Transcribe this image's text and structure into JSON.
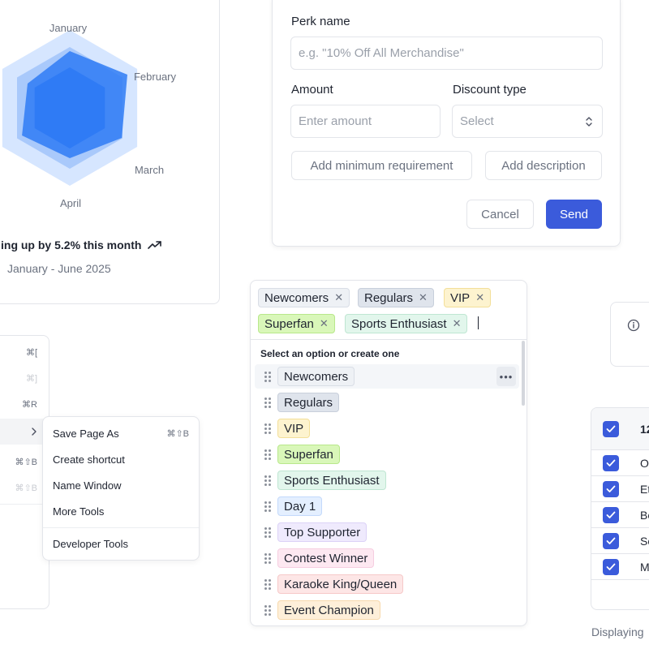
{
  "radar_chart": {
    "month_labels": [
      "January",
      "February",
      "March",
      "April"
    ],
    "trend_text": "ing up by 5.2% this month",
    "trend_icon": "trending-up-icon",
    "date_range": "January - June 2025",
    "colors": {
      "outer": "#d6e6ff",
      "middle": "#a9c9fb",
      "inner": "#2f7bf5"
    }
  },
  "perk_form": {
    "perk_name_label": "Perk name",
    "perk_name_placeholder": "e.g. \"10% Off All Merchandise\"",
    "amount_label": "Amount",
    "amount_placeholder": "Enter amount",
    "discount_type_label": "Discount type",
    "discount_type_value": "Select",
    "add_min_requirement": "Add minimum requirement",
    "add_description": "Add description",
    "cancel": "Cancel",
    "send": "Send",
    "accent_color": "#3b5bdb"
  },
  "context_menu": {
    "shortcuts": [
      {
        "text": "⌘[",
        "dim": false
      },
      {
        "text": "⌘]",
        "dim": true
      },
      {
        "text": "⌘R",
        "dim": false
      },
      {
        "text": "⌘⇧B",
        "dim": false
      },
      {
        "text": "⌘⇧B",
        "dim": true
      }
    ],
    "submenu": [
      {
        "label": "Save Page As",
        "shortcut": "⌘⇧B"
      },
      {
        "label": "Create shortcut",
        "shortcut": ""
      },
      {
        "label": "Name Window",
        "shortcut": ""
      },
      {
        "label": "More Tools",
        "shortcut": ""
      },
      {
        "label": "Developer Tools",
        "shortcut": ""
      }
    ]
  },
  "tag_picker": {
    "selected": [
      {
        "label": "Newcomers",
        "bg": "#eef1f5",
        "border": "#d9dee6"
      },
      {
        "label": "Regulars",
        "bg": "#dfe4ec",
        "border": "#c8cfdb"
      },
      {
        "label": "VIP",
        "bg": "#fdf3cf",
        "border": "#f3df99"
      },
      {
        "label": "Superfan",
        "bg": "#d9f7b9",
        "border": "#b8e88b"
      },
      {
        "label": "Sports Enthusiast",
        "bg": "#e2f6ec",
        "border": "#bfe6d2"
      }
    ],
    "hint": "Select an option or create one",
    "options": [
      {
        "label": "Newcomers",
        "bg": "#eef1f5",
        "border": "#d9dee6"
      },
      {
        "label": "Regulars",
        "bg": "#dfe4ec",
        "border": "#c8cfdb"
      },
      {
        "label": "VIP",
        "bg": "#fdf3cf",
        "border": "#f3df99"
      },
      {
        "label": "Superfan",
        "bg": "#d9f7b9",
        "border": "#b8e88b"
      },
      {
        "label": "Sports Enthusiast",
        "bg": "#e2f6ec",
        "border": "#bfe6d2"
      },
      {
        "label": "Day 1",
        "bg": "#e4efff",
        "border": "#c3d9fb"
      },
      {
        "label": "Top Supporter",
        "bg": "#efeafd",
        "border": "#dcd2f7"
      },
      {
        "label": "Contest Winner",
        "bg": "#fde8f1",
        "border": "#f6cde0"
      },
      {
        "label": "Karaoke King/Queen",
        "bg": "#fde6e6",
        "border": "#f6c9c9"
      },
      {
        "label": "Event Champion",
        "bg": "#feefd9",
        "border": "#f7d9ad"
      }
    ]
  },
  "check_table": {
    "header": "12",
    "rows": [
      "O",
      "Et",
      "Be",
      "Sc",
      "M"
    ],
    "footer": "Displaying"
  }
}
